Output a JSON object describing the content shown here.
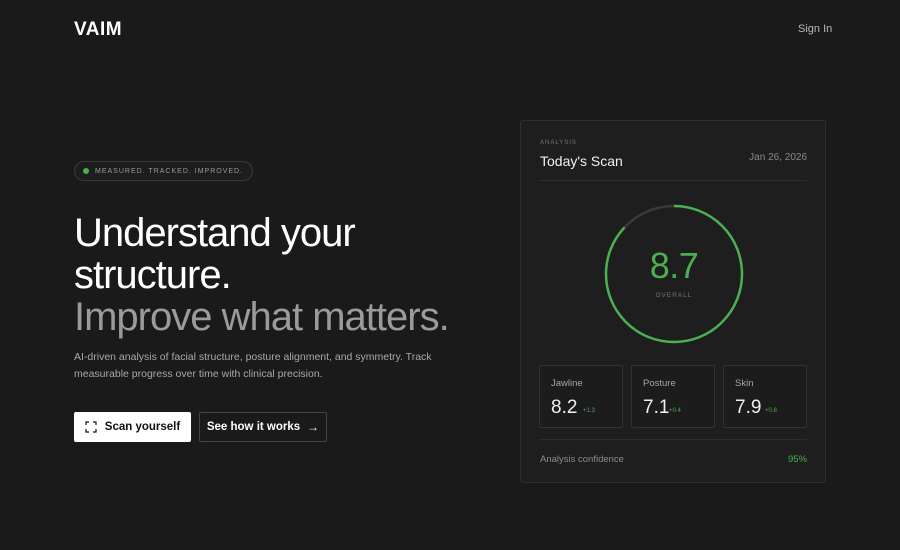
{
  "header": {
    "logo": "VAIM",
    "sign_in": "Sign In"
  },
  "hero": {
    "badge": "MEASURED. TRACKED. IMPROVED.",
    "headline_line1": "Understand your",
    "headline_line2": "structure.",
    "headline_line3": "Improve what matters.",
    "description": "AI-driven analysis of facial structure, posture alignment, and symmetry. Track measurable progress over time with clinical precision.",
    "primary_button": "Scan yourself",
    "secondary_button": "See how it works",
    "secondary_arrow": "→"
  },
  "card": {
    "kicker": "ANALYSIS",
    "title": "Today's Scan",
    "date": "Jan 26, 2026",
    "overall_value": "8.7",
    "overall_label": "OVERALL",
    "overall_progress": 0.87,
    "metrics": [
      {
        "name": "Jawline",
        "value": "8.2",
        "delta": "+1.3"
      },
      {
        "name": "Posture",
        "value": "7.1",
        "delta": "+0.4"
      },
      {
        "name": "Skin",
        "value": "7.9",
        "delta": "+0.8"
      }
    ],
    "confidence_label": "Analysis confidence",
    "confidence_value": "95%"
  },
  "colors": {
    "accent": "#4caf50",
    "background": "#1a1a1a",
    "card": "#1e1e1e"
  },
  "icons": {
    "scan": "scan-frame-icon",
    "arrow": "arrow-right-icon",
    "status": "status-dot-icon"
  }
}
